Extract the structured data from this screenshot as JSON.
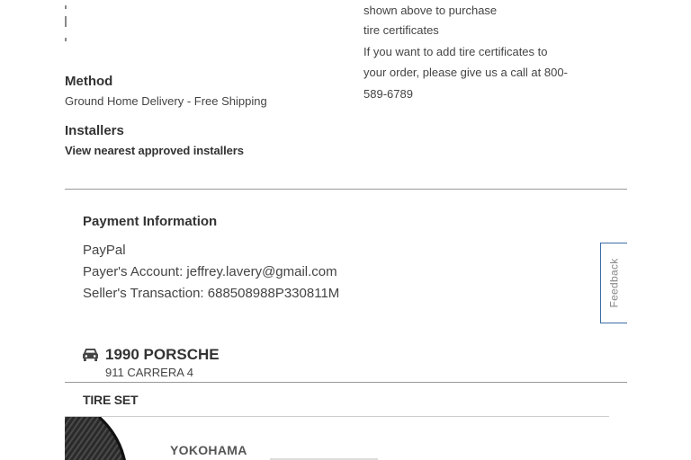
{
  "certificates_note": {
    "line1": "shown above to purchase",
    "line2": "tire certificates",
    "line3": "If you want to add tire certificates to",
    "line4": "your order, please give us a call at 800-",
    "line5": "589-6789"
  },
  "shipping": {
    "method_label": "Method",
    "method_value": "Ground Home Delivery - Free Shipping",
    "installers_label": "Installers",
    "installers_link": "View nearest approved installers"
  },
  "payment": {
    "title": "Payment Information",
    "provider": "PayPal",
    "payer_account": "Payer's Account: jeffrey.lavery@gmail.com",
    "seller_transaction": "Seller's Transaction: 688508988P330811M"
  },
  "feedback": {
    "label": "Feedback"
  },
  "vehicle": {
    "icon": "car-icon",
    "year_make": "1990 PORSCHE",
    "model": "911 CARRERA 4"
  },
  "tire_set": {
    "title": "TIRE SET",
    "brand": "YOKOHAMA"
  },
  "colors": {
    "feedback_border": "#3a6ea5",
    "divider": "#999999"
  }
}
